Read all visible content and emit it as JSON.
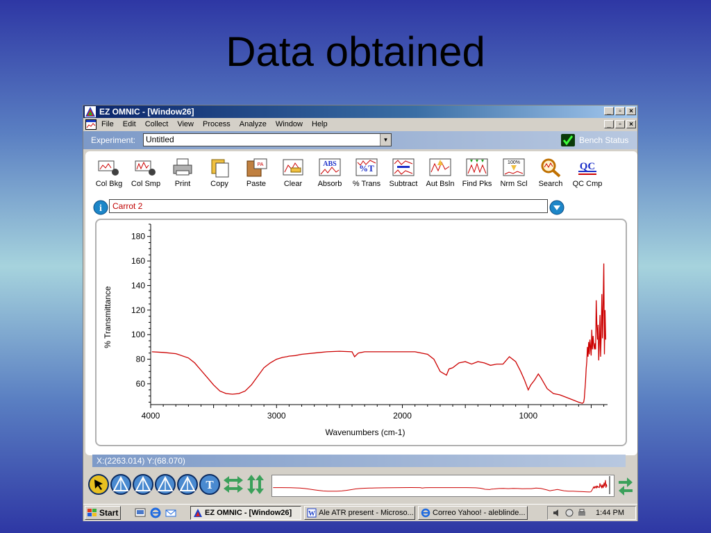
{
  "slide": {
    "title": "Data obtained"
  },
  "window": {
    "title": "EZ OMNIC - [Window26]"
  },
  "menu": [
    "File",
    "Edit",
    "Collect",
    "View",
    "Process",
    "Analyze",
    "Window",
    "Help"
  ],
  "experiment": {
    "label": "Experiment:",
    "value": "Untitled",
    "bench_label": "Bench Status"
  },
  "toolbar": [
    {
      "label": "Col Bkg",
      "icon": "collect-background-icon"
    },
    {
      "label": "Col Smp",
      "icon": "collect-sample-icon"
    },
    {
      "label": "Print",
      "icon": "printer-icon"
    },
    {
      "label": "Copy",
      "icon": "copy-icon"
    },
    {
      "label": "Paste",
      "icon": "paste-icon"
    },
    {
      "label": "Clear",
      "icon": "clear-icon"
    },
    {
      "label": "Absorb",
      "icon": "absorbance-icon"
    },
    {
      "label": "% Trans",
      "icon": "transmittance-icon"
    },
    {
      "label": "Subtract",
      "icon": "subtract-icon"
    },
    {
      "label": "Aut Bsln",
      "icon": "auto-baseline-icon"
    },
    {
      "label": "Find Pks",
      "icon": "find-peaks-icon"
    },
    {
      "label": "Nrm Scl",
      "icon": "normalize-scale-icon"
    },
    {
      "label": "Search",
      "icon": "search-icon"
    },
    {
      "label": "QC Cmp",
      "icon": "qc-compare-icon"
    }
  ],
  "sample": {
    "name": "Carrot 2"
  },
  "chart_data": {
    "type": "line",
    "xlabel": "Wavenumbers (cm-1)",
    "ylabel": "% Transmittance",
    "xlim": [
      4000,
      370
    ],
    "ylim": [
      43,
      190
    ],
    "xticks": [
      4000,
      3000,
      2000,
      1000
    ],
    "yticks": [
      60,
      80,
      100,
      120,
      140,
      160,
      180
    ],
    "color": "#cc0000",
    "series": [
      {
        "x": [
          3990,
          3900,
          3800,
          3700,
          3650,
          3600,
          3550,
          3500,
          3450,
          3400,
          3350,
          3300,
          3250,
          3200,
          3150,
          3100,
          3050,
          3000,
          2950,
          2920,
          2900,
          2850,
          2800,
          2700,
          2600,
          2500,
          2400,
          2380,
          2350,
          2300,
          2200,
          2100,
          2000,
          1900,
          1800,
          1750,
          1700,
          1650,
          1630,
          1600,
          1550,
          1500,
          1450,
          1400,
          1350,
          1300,
          1250,
          1200,
          1150,
          1100,
          1060,
          1030,
          1000,
          980,
          950,
          920,
          900,
          850,
          800,
          750,
          700,
          650,
          600,
          570,
          560,
          555,
          550,
          545,
          540,
          535,
          530,
          525,
          520,
          515,
          510,
          505,
          500,
          495,
          490,
          485,
          480,
          475,
          470,
          465,
          460,
          455,
          450,
          445,
          440,
          435,
          430,
          425,
          420,
          415,
          410,
          405,
          400,
          395,
          390,
          385
        ],
        "y": [
          86,
          85.5,
          84.5,
          81,
          77,
          71,
          65,
          59,
          54,
          52,
          51.5,
          52,
          54,
          59,
          66,
          73,
          77,
          80,
          81.5,
          82,
          82.5,
          83,
          84,
          85,
          86,
          86.5,
          86,
          82,
          85,
          86,
          86,
          86,
          86,
          86,
          84,
          80,
          70,
          67,
          72,
          73,
          77,
          78,
          76,
          78,
          77,
          75,
          76,
          76,
          82,
          78,
          70,
          63,
          55,
          59,
          63,
          68,
          65,
          56,
          52,
          51,
          49,
          47,
          45,
          44,
          45,
          48,
          55,
          62,
          72,
          78,
          90,
          82,
          94,
          84,
          96,
          90,
          83,
          104,
          88,
          99,
          92,
          88,
          93,
          88,
          128,
          108,
          96,
          108,
          79,
          94,
          116,
          82,
          100,
          133,
          97,
          126,
          158,
          84,
          120,
          96
        ]
      }
    ]
  },
  "status": {
    "coords": "X:(2263.014) Y:(68.070)"
  },
  "nav_buttons": [
    {
      "name": "select-tool-icon"
    },
    {
      "name": "region-tool-icon"
    },
    {
      "name": "peak-tool-icon"
    },
    {
      "name": "peak-height-icon"
    },
    {
      "name": "peak-area-icon"
    },
    {
      "name": "annotation-tool-icon"
    },
    {
      "name": "expand-horizontal-icon"
    },
    {
      "name": "expand-vertical-icon"
    }
  ],
  "taskbar": {
    "start": "Start",
    "tasks": [
      {
        "label": "EZ OMNIC - [Window26]",
        "active": true
      },
      {
        "label": "Ale ATR present - Microso...",
        "active": false
      },
      {
        "label": "Correo Yahoo! - aleblinde...",
        "active": false
      }
    ],
    "time": "1:44 PM"
  }
}
